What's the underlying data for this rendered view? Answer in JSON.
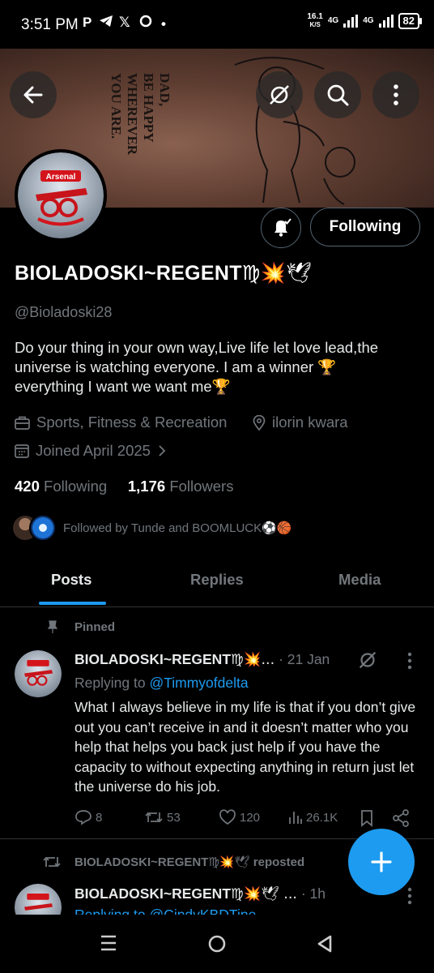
{
  "status_bar": {
    "time": "3:51 PM",
    "net_speed": "16.1",
    "net_unit": "K/S",
    "net1": "4G",
    "net2": "4G",
    "battery": "82"
  },
  "banner": {
    "text_line1": "DAD,",
    "text_line2": "BE HAPPY",
    "text_line3": "WHEREVER",
    "text_line4": "YOU ARE."
  },
  "avatar": {
    "logo_text": "Arsenal"
  },
  "profile": {
    "following_button": "Following",
    "display_name": "BIOLADOSKI~REGENT",
    "display_emojis": "♍💥🕊",
    "handle": "@Bioladoski28",
    "bio": "Do your thing in your own way,Live life let love lead,the universe is watching everyone. I am a winner 🏆\neverything I want we want  me🏆",
    "category": "Sports, Fitness & Recreation",
    "location": "ilorin kwara",
    "joined": "Joined April 2025",
    "following_count": "420",
    "following_label": "Following",
    "followers_count": "1,176",
    "followers_label": "Followers",
    "followed_by": "Followed by Tunde and BOOMLUCK⚽🏀"
  },
  "tabs": [
    {
      "label": "Posts",
      "active": true
    },
    {
      "label": "Replies",
      "active": false
    },
    {
      "label": "Media",
      "active": false
    }
  ],
  "pinned_post": {
    "pinned_label": "Pinned",
    "author": "BIOLADOSKI~REGENT",
    "author_emojis": "♍💥...",
    "time": "· 21 Jan",
    "replying_prefix": "Replying to",
    "replying_to": "@Timmyofdelta",
    "text": "What I always believe in my life is that if you don’t give out you can’t receive in and it doesn’t matter who you help that helps you back just help if you have the capacity to without expecting anything in return just let the universe do his job.",
    "replies": "8",
    "reposts": "53",
    "likes": "120",
    "views": "26.1K"
  },
  "repost": {
    "reposted_by": "BIOLADOSKI~REGENT",
    "reposted_emojis": "♍💥🕊",
    "reposted_label": "reposted",
    "author": "BIOLADOSKI~REGENT",
    "author_emojis": "♍💥🕊 ...",
    "time": "· 1h",
    "replying_partial": "Replying to @CindyKBDTine"
  },
  "colors": {
    "accent": "#1d9bf0",
    "muted": "#71767b",
    "text": "#e7e9ea",
    "background": "#000000",
    "border": "#2f3336"
  }
}
